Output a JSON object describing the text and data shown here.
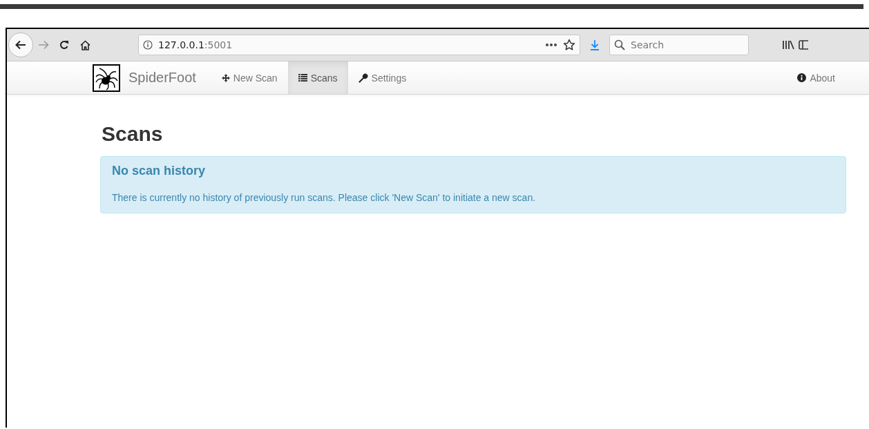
{
  "browser": {
    "url_host": "127.0.0.1",
    "url_port": ":5001",
    "search_placeholder": "Search"
  },
  "navbar": {
    "brand": "SpiderFoot",
    "items": [
      {
        "label": "New Scan",
        "selected": false
      },
      {
        "label": "Scans",
        "selected": true
      },
      {
        "label": "Settings",
        "selected": false
      }
    ],
    "right_item": {
      "label": "About",
      "selected": false
    }
  },
  "page": {
    "title": "Scans",
    "alert": {
      "heading": "No scan history",
      "message": "There is currently no history of previously run scans. Please click 'New Scan' to initiate a new scan."
    }
  }
}
